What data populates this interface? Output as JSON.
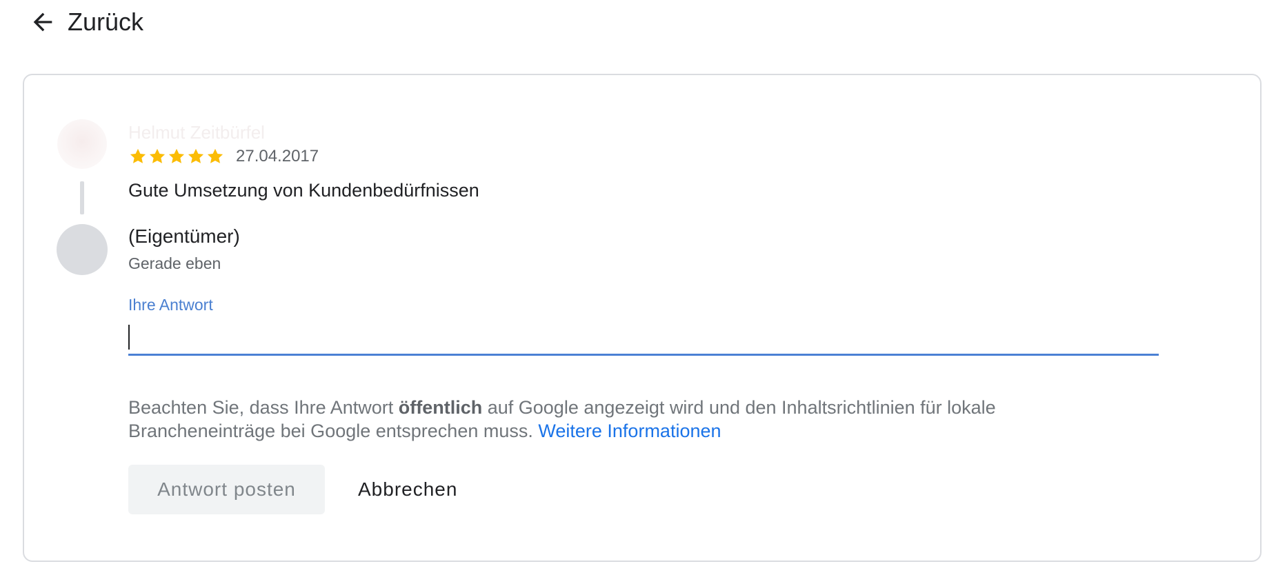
{
  "header": {
    "back_label": "Zurück",
    "back_icon": "arrow-left-icon"
  },
  "review": {
    "reviewer_name": "Helmut Zeitbürfel",
    "rating": 5,
    "date": "27.04.2017",
    "text": "Gute Umsetzung von Kundenbedürfnissen",
    "star_color": "#fbbc04"
  },
  "reply": {
    "owner_label": "(Eigentümer)",
    "time": "Gerade eben",
    "field_label": "Ihre Antwort",
    "value": "",
    "accent_color": "#4a80d4"
  },
  "notice": {
    "text_before": "Beachten Sie, dass Ihre Antwort ",
    "bold": "öffentlich",
    "text_after": " auf Google angezeigt wird und den Inhaltsrichtlinien für lokale Brancheneinträge bei Google entsprechen muss. ",
    "link": "Weitere Informationen"
  },
  "actions": {
    "post_label": "Antwort posten",
    "cancel_label": "Abbrechen"
  }
}
